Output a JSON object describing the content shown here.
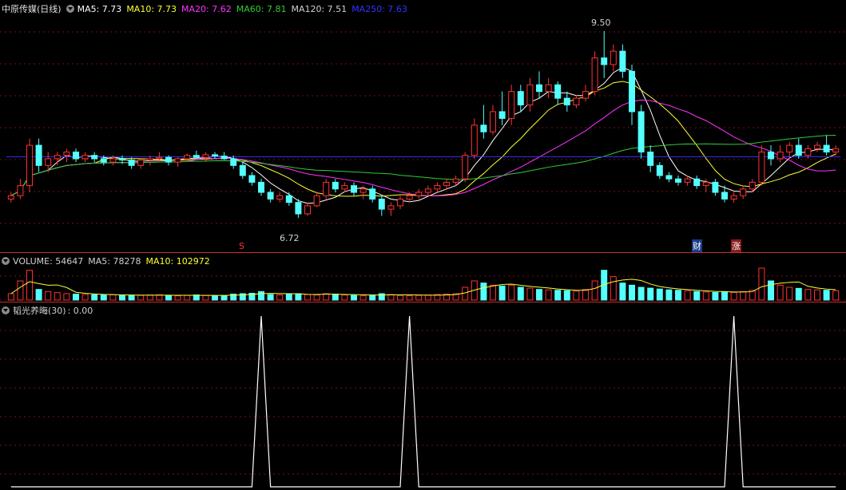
{
  "main": {
    "title": "中原传媒(日线)",
    "ma": [
      {
        "label": "MA5: 7.73",
        "color": "#ffffff"
      },
      {
        "label": "MA10: 7.73",
        "color": "#ffff33"
      },
      {
        "label": "MA20: 7.62",
        "color": "#ff33ff"
      },
      {
        "label": "MA60: 7.81",
        "color": "#33cc33"
      },
      {
        "label": "MA120: 7.51",
        "color": "#d0d0d0"
      },
      {
        "label": "MA250: 7.63",
        "color": "#3333ff"
      }
    ],
    "high_label": "9.50",
    "low_label": "6.72",
    "markers": {
      "s": "S",
      "cai": "财",
      "zhang": "涨"
    }
  },
  "volume": {
    "labels": [
      {
        "label": "VOLUME: 54647",
        "color": "#d0d0d0"
      },
      {
        "label": "MA5: 78278",
        "color": "#d0d0d0"
      },
      {
        "label": "MA10: 102972",
        "color": "#ffff33"
      }
    ]
  },
  "indicator": {
    "name": "韬光养晦(30)",
    "value": ": 0.00"
  },
  "colors": {
    "up": "#ff3232",
    "down": "#54ffff",
    "grid": "#7a1010",
    "divider": "#c0302f"
  },
  "chart_data": {
    "type": "candlestick",
    "price_range": [
      6.4,
      9.7
    ],
    "candles": [
      [
        7.0,
        7.1,
        6.95,
        7.05
      ],
      [
        7.05,
        7.3,
        7.0,
        7.2
      ],
      [
        7.2,
        7.9,
        7.1,
        7.8
      ],
      [
        7.8,
        7.9,
        7.4,
        7.5
      ],
      [
        7.5,
        7.7,
        7.4,
        7.6
      ],
      [
        7.6,
        7.7,
        7.5,
        7.65
      ],
      [
        7.65,
        7.75,
        7.55,
        7.7
      ],
      [
        7.7,
        7.75,
        7.55,
        7.6
      ],
      [
        7.6,
        7.7,
        7.55,
        7.65
      ],
      [
        7.65,
        7.7,
        7.55,
        7.6
      ],
      [
        7.6,
        7.65,
        7.5,
        7.55
      ],
      [
        7.55,
        7.65,
        7.5,
        7.6
      ],
      [
        7.6,
        7.65,
        7.52,
        7.58
      ],
      [
        7.58,
        7.62,
        7.45,
        7.5
      ],
      [
        7.5,
        7.6,
        7.45,
        7.58
      ],
      [
        7.58,
        7.65,
        7.5,
        7.6
      ],
      [
        7.6,
        7.7,
        7.55,
        7.62
      ],
      [
        7.62,
        7.65,
        7.5,
        7.55
      ],
      [
        7.55,
        7.62,
        7.48,
        7.6
      ],
      [
        7.6,
        7.68,
        7.55,
        7.65
      ],
      [
        7.65,
        7.72,
        7.6,
        7.62
      ],
      [
        7.62,
        7.7,
        7.55,
        7.66
      ],
      [
        7.66,
        7.7,
        7.6,
        7.64
      ],
      [
        7.64,
        7.7,
        7.58,
        7.6
      ],
      [
        7.6,
        7.65,
        7.45,
        7.5
      ],
      [
        7.5,
        7.55,
        7.3,
        7.35
      ],
      [
        7.35,
        7.4,
        7.2,
        7.25
      ],
      [
        7.25,
        7.3,
        7.05,
        7.1
      ],
      [
        7.1,
        7.15,
        6.95,
        7.0
      ],
      [
        7.0,
        7.1,
        6.95,
        7.05
      ],
      [
        7.05,
        7.1,
        6.9,
        6.95
      ],
      [
        6.95,
        7.0,
        6.72,
        6.78
      ],
      [
        6.78,
        6.95,
        6.75,
        6.9
      ],
      [
        6.9,
        7.1,
        6.88,
        7.05
      ],
      [
        7.05,
        7.3,
        7.0,
        7.25
      ],
      [
        7.25,
        7.3,
        7.1,
        7.15
      ],
      [
        7.15,
        7.25,
        7.1,
        7.2
      ],
      [
        7.2,
        7.25,
        7.05,
        7.1
      ],
      [
        7.1,
        7.2,
        7.0,
        7.15
      ],
      [
        7.15,
        7.2,
        6.95,
        7.0
      ],
      [
        7.0,
        7.05,
        6.75,
        6.85
      ],
      [
        6.85,
        6.95,
        6.75,
        6.9
      ],
      [
        6.9,
        7.05,
        6.85,
        7.0
      ],
      [
        7.0,
        7.1,
        6.95,
        7.05
      ],
      [
        7.05,
        7.15,
        7.0,
        7.1
      ],
      [
        7.1,
        7.2,
        7.05,
        7.15
      ],
      [
        7.15,
        7.25,
        7.1,
        7.2
      ],
      [
        7.2,
        7.3,
        7.15,
        7.25
      ],
      [
        7.25,
        7.35,
        7.2,
        7.3
      ],
      [
        7.3,
        7.7,
        7.25,
        7.65
      ],
      [
        7.65,
        8.2,
        7.6,
        8.1
      ],
      [
        8.1,
        8.4,
        7.9,
        8.0
      ],
      [
        8.0,
        8.4,
        7.95,
        8.3
      ],
      [
        8.3,
        8.6,
        8.1,
        8.2
      ],
      [
        8.2,
        8.7,
        8.1,
        8.6
      ],
      [
        8.6,
        8.7,
        8.3,
        8.4
      ],
      [
        8.4,
        8.8,
        8.3,
        8.7
      ],
      [
        8.7,
        8.9,
        8.5,
        8.6
      ],
      [
        8.6,
        8.8,
        8.5,
        8.7
      ],
      [
        8.7,
        8.75,
        8.4,
        8.5
      ],
      [
        8.5,
        8.6,
        8.3,
        8.4
      ],
      [
        8.4,
        8.55,
        8.35,
        8.5
      ],
      [
        8.5,
        8.7,
        8.45,
        8.6
      ],
      [
        8.6,
        9.2,
        8.55,
        9.1
      ],
      [
        9.1,
        9.5,
        8.8,
        9.0
      ],
      [
        9.0,
        9.3,
        8.9,
        9.2
      ],
      [
        9.2,
        9.3,
        8.8,
        8.9
      ],
      [
        8.9,
        9.0,
        8.1,
        8.3
      ],
      [
        8.3,
        8.4,
        7.6,
        7.7
      ],
      [
        7.7,
        7.8,
        7.4,
        7.5
      ],
      [
        7.5,
        7.55,
        7.3,
        7.35
      ],
      [
        7.35,
        7.4,
        7.25,
        7.3
      ],
      [
        7.3,
        7.35,
        7.2,
        7.25
      ],
      [
        7.25,
        7.35,
        7.2,
        7.3
      ],
      [
        7.3,
        7.35,
        7.15,
        7.2
      ],
      [
        7.2,
        7.3,
        7.1,
        7.25
      ],
      [
        7.25,
        7.3,
        7.05,
        7.1
      ],
      [
        7.1,
        7.2,
        6.95,
        7.0
      ],
      [
        7.0,
        7.1,
        6.95,
        7.05
      ],
      [
        7.05,
        7.2,
        7.0,
        7.15
      ],
      [
        7.15,
        7.3,
        7.1,
        7.25
      ],
      [
        7.25,
        7.8,
        7.2,
        7.7
      ],
      [
        7.7,
        7.8,
        7.5,
        7.6
      ],
      [
        7.6,
        7.8,
        7.55,
        7.7
      ],
      [
        7.7,
        7.85,
        7.6,
        7.8
      ],
      [
        7.8,
        7.9,
        7.6,
        7.65
      ],
      [
        7.65,
        7.8,
        7.6,
        7.75
      ],
      [
        7.75,
        7.85,
        7.7,
        7.8
      ],
      [
        7.8,
        7.95,
        7.65,
        7.7
      ],
      [
        7.7,
        7.8,
        7.65,
        7.75
      ]
    ],
    "volume": [
      30,
      90,
      140,
      50,
      40,
      35,
      30,
      28,
      26,
      25,
      24,
      25,
      23,
      22,
      22,
      24,
      25,
      22,
      20,
      22,
      24,
      22,
      21,
      20,
      28,
      30,
      32,
      40,
      26,
      24,
      28,
      30,
      26,
      24,
      30,
      28,
      24,
      22,
      20,
      24,
      30,
      26,
      22,
      20,
      22,
      24,
      26,
      28,
      30,
      60,
      90,
      80,
      70,
      66,
      70,
      60,
      56,
      50,
      48,
      46,
      44,
      42,
      50,
      90,
      140,
      110,
      80,
      70,
      60,
      56,
      52,
      48,
      46,
      44,
      40,
      38,
      36,
      40,
      36,
      40,
      46,
      150,
      90,
      70,
      60,
      55,
      50,
      48,
      46,
      44
    ],
    "indicator": [
      0,
      0,
      0,
      0,
      0,
      0,
      0,
      0,
      0,
      0,
      0,
      0,
      0,
      0,
      0,
      0,
      0,
      0,
      0,
      0,
      0,
      0,
      0,
      0,
      0,
      0,
      0,
      1,
      0,
      0,
      0,
      0,
      0,
      0,
      0,
      0,
      0,
      0,
      0,
      0,
      0,
      0,
      0,
      1,
      0,
      0,
      0,
      0,
      0,
      0,
      0,
      0,
      0,
      0,
      0,
      0,
      0,
      0,
      0,
      0,
      0,
      0,
      0,
      0,
      0,
      0,
      0,
      0,
      0,
      0,
      0,
      0,
      0,
      0,
      0,
      0,
      0,
      0,
      1,
      0,
      0,
      0,
      0,
      0,
      0,
      0,
      0,
      0,
      0,
      0
    ]
  }
}
